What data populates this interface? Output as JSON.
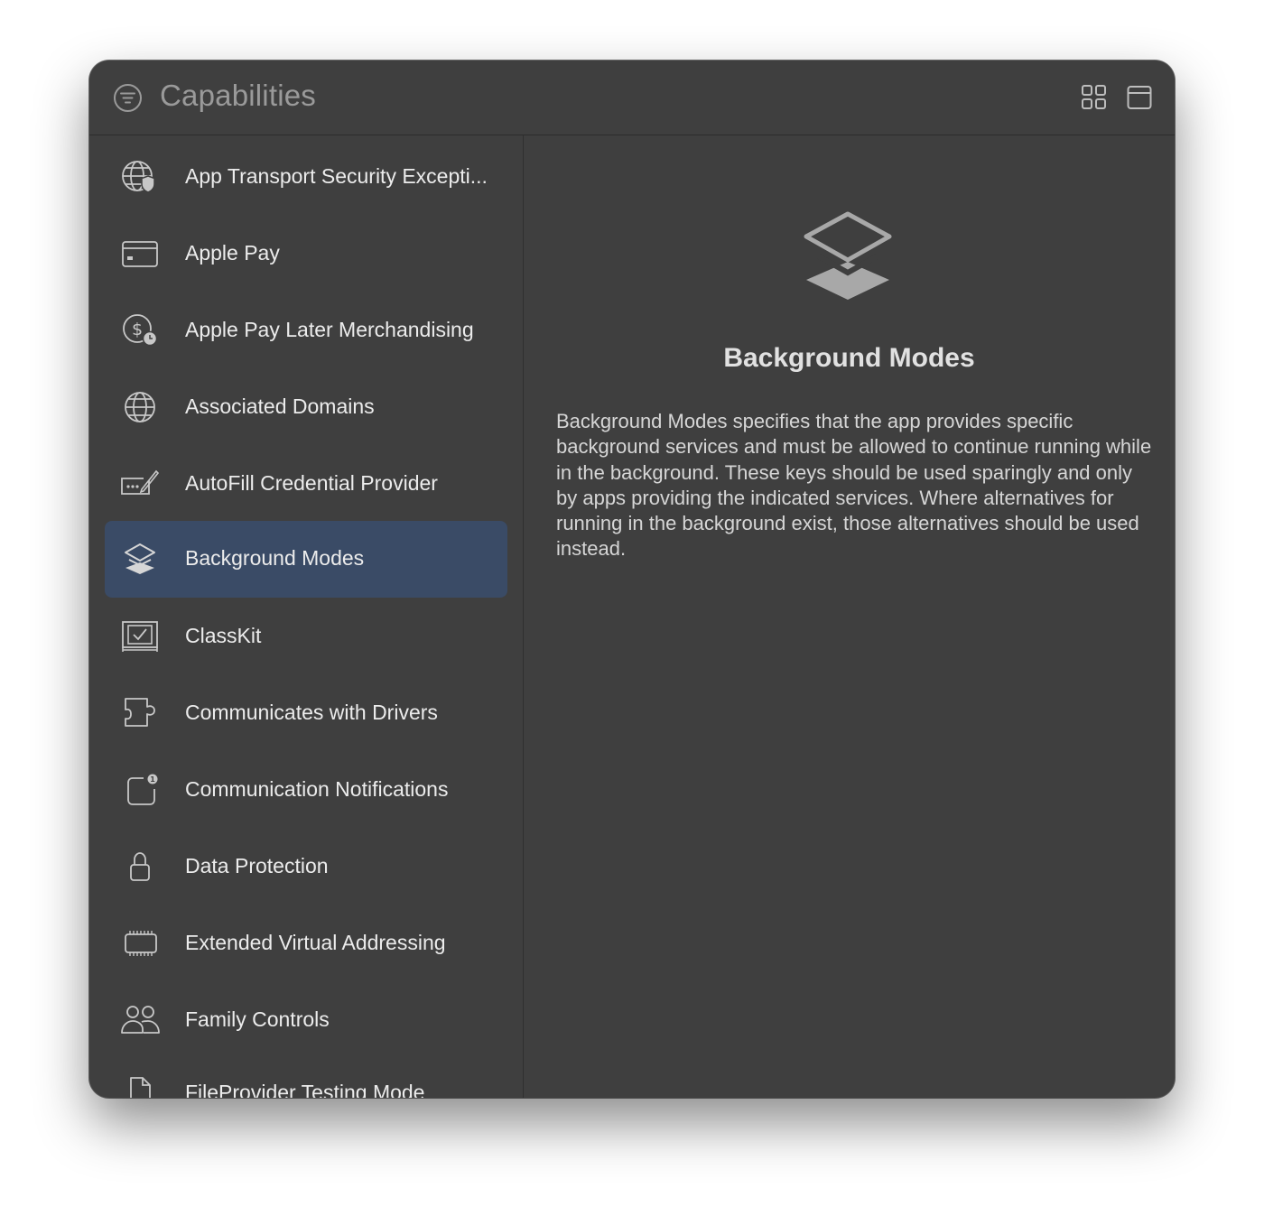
{
  "window": {
    "title": "Capabilities"
  },
  "toolbar": {
    "filter_icon": "filter-circle-icon",
    "grid_icon": "grid-view-icon",
    "window_icon": "window-icon"
  },
  "sidebar": {
    "items": [
      {
        "label": "App Transport Security Excepti...",
        "icon": "globe-shield-icon"
      },
      {
        "label": "Apple Pay",
        "icon": "credit-card-icon"
      },
      {
        "label": "Apple Pay Later Merchandising",
        "icon": "dollar-clock-icon"
      },
      {
        "label": "Associated Domains",
        "icon": "globe-icon"
      },
      {
        "label": "AutoFill Credential Provider",
        "icon": "password-field-icon"
      },
      {
        "label": "Background Modes",
        "icon": "layers-icon",
        "selected": true
      },
      {
        "label": "ClassKit",
        "icon": "classroom-check-icon"
      },
      {
        "label": "Communicates with Drivers",
        "icon": "puzzle-piece-icon"
      },
      {
        "label": "Communication Notifications",
        "icon": "app-badge-icon"
      },
      {
        "label": "Data Protection",
        "icon": "lock-icon"
      },
      {
        "label": "Extended Virtual Addressing",
        "icon": "memory-chip-icon"
      },
      {
        "label": "Family Controls",
        "icon": "people-icon"
      },
      {
        "label": "FileProvider Testing Mode",
        "icon": "document-icon"
      }
    ]
  },
  "detail": {
    "icon": "layers-icon",
    "title": "Background Modes",
    "description": "Background Modes specifies that the app provides specific background services and must be allowed to continue running while in the background. These keys should be used sparingly and only by apps providing the indicated services. Where alternatives for running in the background exist, those alternatives should be used instead."
  },
  "colors": {
    "window_bg": "#3f3f3f",
    "selection": "#3a4b66",
    "text": "#ececec",
    "title_text": "#9a9a9a"
  }
}
